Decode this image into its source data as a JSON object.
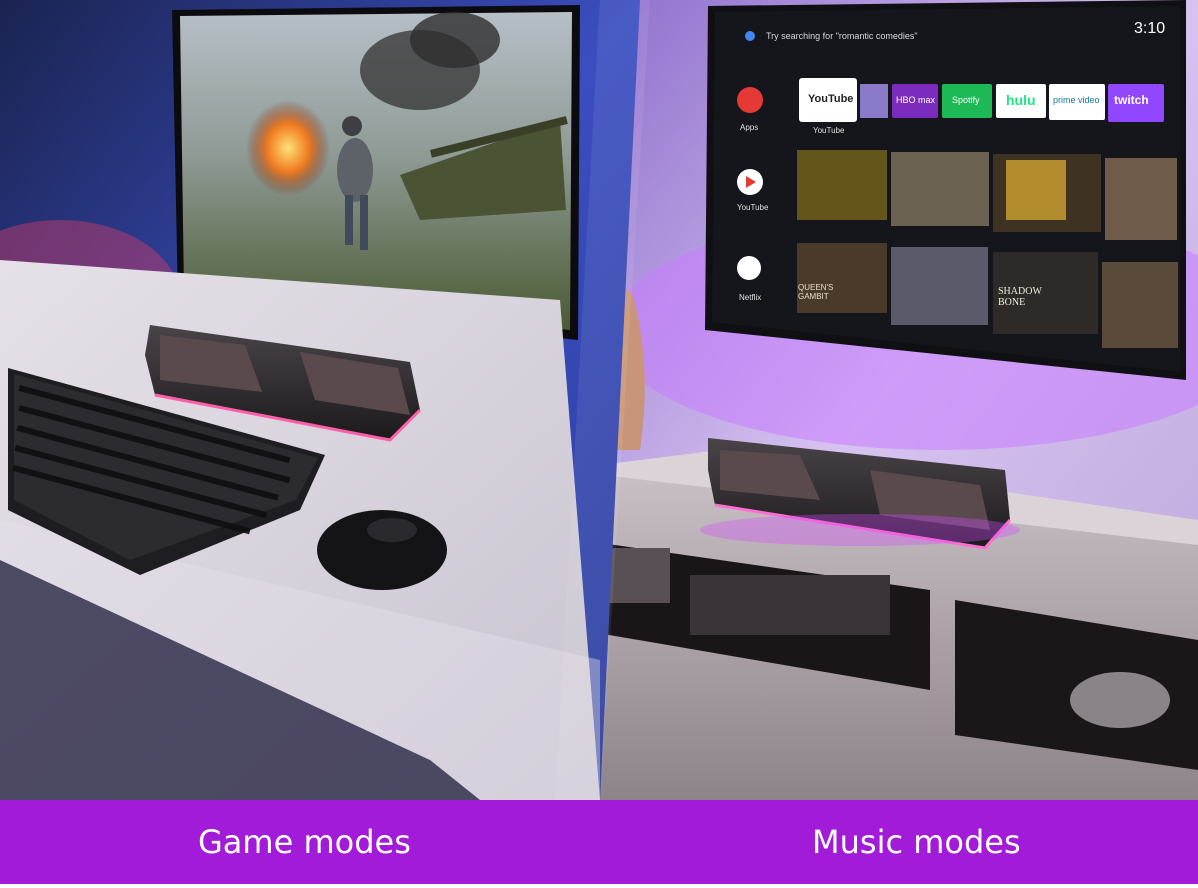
{
  "captions": {
    "left": "Game modes",
    "right": "Music modes"
  },
  "tv_launcher": {
    "search_hint": "Try searching for \"romantic comedies\"",
    "clock": "3:10",
    "sidebar": [
      {
        "label": "Apps"
      },
      {
        "label": "YouTube"
      },
      {
        "label": "Netflix"
      }
    ],
    "apps": [
      {
        "name": "YouTube",
        "color": "#ffffff"
      },
      {
        "name": "HBO max",
        "color": "#7b2cbf"
      },
      {
        "name": "Spotify",
        "color": "#1db954"
      },
      {
        "name": "hulu",
        "color": "#ffffff"
      },
      {
        "name": "prime video",
        "color": "#ffffff"
      },
      {
        "name": "twitch",
        "color": "#9146ff"
      }
    ],
    "focused_app_label": "YouTube",
    "posters": [
      "QUEEN'S GAMBIT",
      "SHADOW BONE"
    ]
  },
  "colors": {
    "accent_band": "#a21bd9",
    "caption_text": "#ffffff"
  }
}
